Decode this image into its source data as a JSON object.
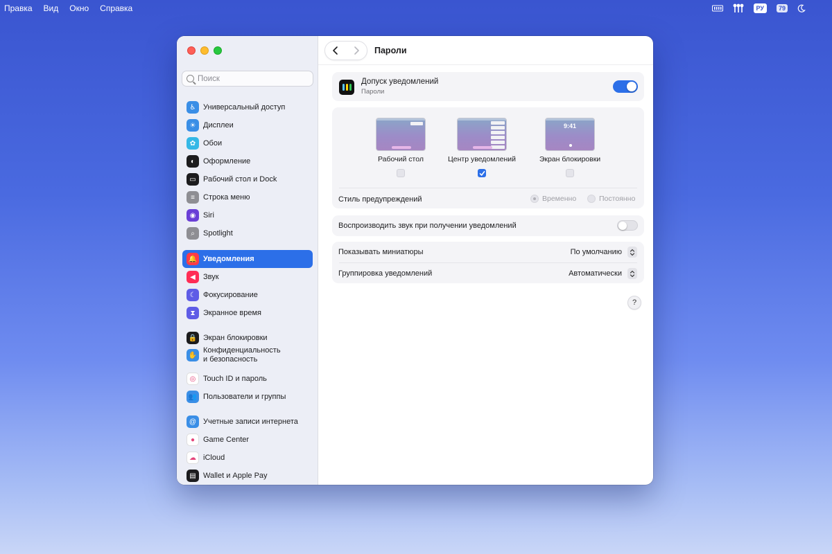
{
  "menubar": {
    "items": [
      "Правка",
      "Вид",
      "Окно",
      "Справка"
    ],
    "keyboard_layout": "РУ",
    "battery": "79"
  },
  "window": {
    "title": "Пароли",
    "search": {
      "placeholder": "Поиск"
    },
    "sidebar": {
      "items": [
        {
          "label": "Универсальный доступ",
          "icon": "accessibility-icon",
          "color": "#3a8ee6"
        },
        {
          "label": "Дисплеи",
          "icon": "display-brightness-icon",
          "color": "#3a8ee6"
        },
        {
          "label": "Обои",
          "icon": "wallpaper-flower-icon",
          "color": "#35b8e6"
        },
        {
          "label": "Оформление",
          "icon": "appearance-icon",
          "color": "#1c1c1e"
        },
        {
          "label": "Рабочий стол и Dock",
          "icon": "desktop-dock-icon",
          "color": "#1c1c1e"
        },
        {
          "label": "Строка меню",
          "icon": "menubar-icon",
          "color": "#8e8e93"
        },
        {
          "label": "Siri",
          "icon": "siri-icon",
          "color": "#6a3fd6"
        },
        {
          "label": "Spotlight",
          "icon": "spotlight-search-icon",
          "color": "#8e8e93"
        },
        {
          "label": "Уведомления",
          "icon": "bell-icon",
          "color": "#ff3b47"
        },
        {
          "label": "Звук",
          "icon": "speaker-icon",
          "color": "#ff2d55"
        },
        {
          "label": "Фокусирование",
          "icon": "moon-icon",
          "color": "#5e5ce6"
        },
        {
          "label": "Экранное время",
          "icon": "hourglass-icon",
          "color": "#5e5ce6"
        },
        {
          "label": "Экран блокировки",
          "icon": "lock-icon",
          "color": "#1c1c1e"
        },
        {
          "label": "Конфиденциальность\nи безопасность",
          "icon": "hand-icon",
          "color": "#3a8ee6"
        },
        {
          "label": "Touch ID и пароль",
          "icon": "fingerprint-icon",
          "color": "#ffffff"
        },
        {
          "label": "Пользователи и группы",
          "icon": "users-icon",
          "color": "#3a8ee6"
        },
        {
          "label": "Учетные записи интернета",
          "icon": "at-sign-icon",
          "color": "#3a8ee6"
        },
        {
          "label": "Game Center",
          "icon": "game-center-icon",
          "color": "#ffffff"
        },
        {
          "label": "iCloud",
          "icon": "icloud-icon",
          "color": "#ffffff"
        },
        {
          "label": "Wallet и Apple Pay",
          "icon": "wallet-icon",
          "color": "#1c1c1e"
        }
      ],
      "active_index": 8
    },
    "allow": {
      "title": "Допуск уведомлений",
      "subtitle": "Пароли",
      "enabled": true
    },
    "previews": [
      {
        "label": "Рабочий стол",
        "checked": false
      },
      {
        "label": "Центр уведомлений",
        "checked": true
      },
      {
        "label": "Экран блокировки",
        "checked": false,
        "clock": "9:41"
      }
    ],
    "alert_style": {
      "label": "Стиль предупреждений",
      "options": [
        "Временно",
        "Постоянно"
      ],
      "selected": "Временно"
    },
    "sound": {
      "label": "Воспроизводить звук при получении уведомлений",
      "enabled": false
    },
    "previews_setting": {
      "label": "Показывать миниатюры",
      "value": "По умолчанию"
    },
    "grouping": {
      "label": "Группировка уведомлений",
      "value": "Автоматически"
    },
    "help": "?"
  },
  "colors": {
    "accent": "#2c6fe8"
  }
}
